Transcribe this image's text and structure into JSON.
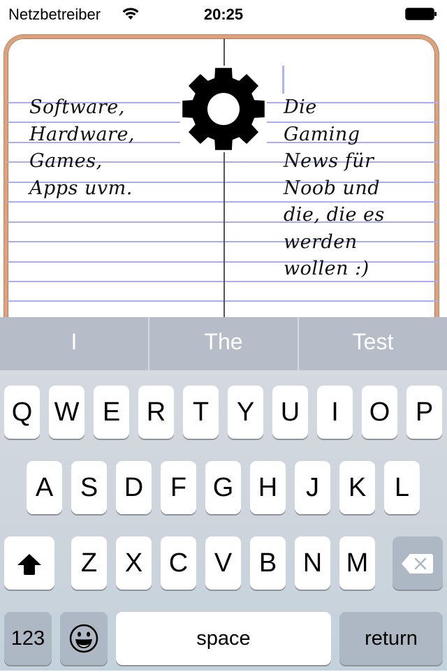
{
  "status_bar": {
    "carrier": "Netzbetreiber",
    "time": "20:25",
    "wifi_icon": "wifi-icon",
    "battery_icon": "battery-icon"
  },
  "notebook": {
    "left_text": "Software,\nHardware,\nGames,\nApps uvm.",
    "right_text": "Die\nGaming\nNews für\nNoob und\ndie, die es\nwerden\nwollen :)",
    "center_icon": "gear-icon",
    "colors": {
      "border": "#dca27e",
      "ruled_line": "#a9aef0",
      "divider": "#555555"
    }
  },
  "suggestions": {
    "items": [
      "I",
      "The",
      "Test"
    ]
  },
  "keyboard": {
    "row1": [
      "Q",
      "W",
      "E",
      "R",
      "T",
      "Y",
      "U",
      "I",
      "O",
      "P"
    ],
    "row2": [
      "A",
      "S",
      "D",
      "F",
      "G",
      "H",
      "J",
      "K",
      "L"
    ],
    "row3": [
      "Z",
      "X",
      "C",
      "V",
      "B",
      "N",
      "M"
    ],
    "shift_icon": "shift-icon",
    "delete_icon": "backspace-icon",
    "numbers_label": "123",
    "emoji_icon": "emoji-icon",
    "space_label": "space",
    "return_label": "return"
  }
}
